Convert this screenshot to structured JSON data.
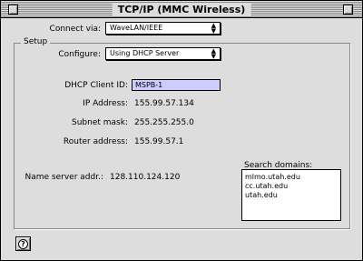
{
  "window": {
    "title": "TCP/IP (MMC Wireless)"
  },
  "connect": {
    "label": "Connect via:",
    "value": "WaveLAN/IEEE"
  },
  "setup": {
    "legend": "Setup",
    "configure_label": "Configure:",
    "configure_value": "Using DHCP Server",
    "dhcp_label": "DHCP Client ID:",
    "dhcp_value": "MSPB-1",
    "ip_label": "IP Address:",
    "ip_value": "155.99.57.134",
    "subnet_label": "Subnet mask:",
    "subnet_value": "255.255.255.0",
    "router_label": "Router address:",
    "router_value": "155.99.57.1",
    "nameserver_label": "Name server addr.:",
    "nameserver_value": "128.110.124.120",
    "search_label": "Search domains:",
    "search_domains": [
      "mlmo.utah.edu",
      "cc.utah.edu",
      "utah.edu"
    ]
  },
  "help": {
    "glyph": "?"
  }
}
